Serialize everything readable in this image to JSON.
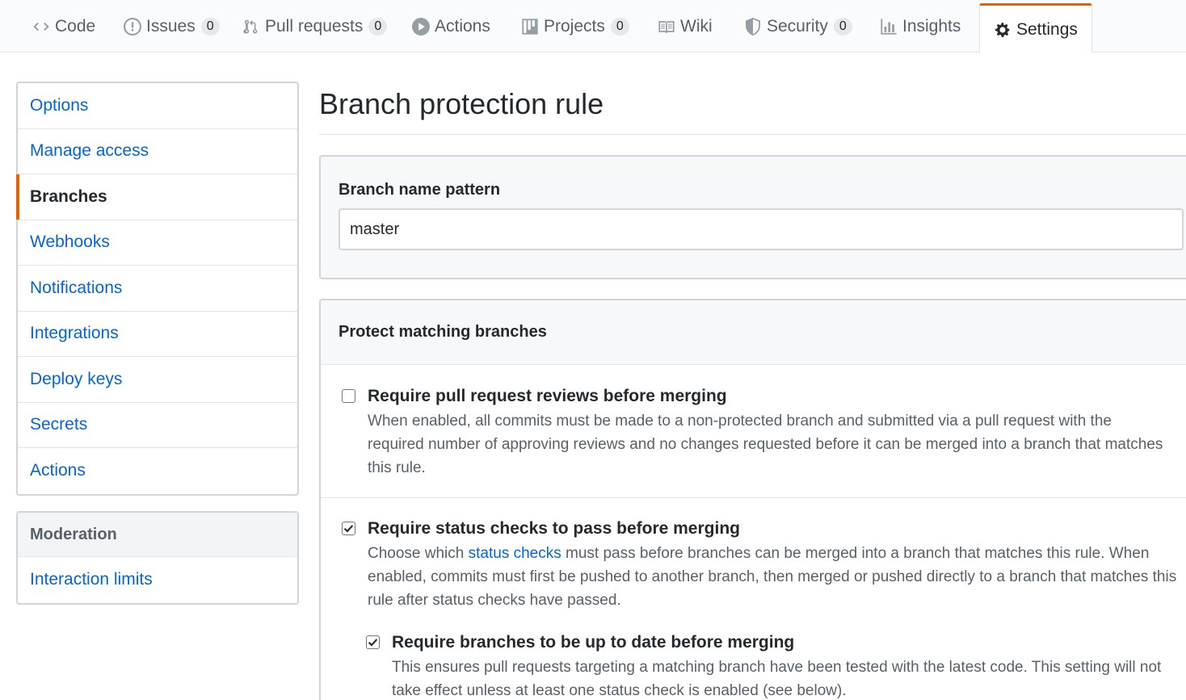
{
  "tabs": [
    {
      "icon": "code-icon",
      "label": "Code"
    },
    {
      "icon": "issue-icon",
      "label": "Issues",
      "count": "0"
    },
    {
      "icon": "pull-request-icon",
      "label": "Pull requests",
      "count": "0"
    },
    {
      "icon": "play-icon",
      "label": "Actions"
    },
    {
      "icon": "project-icon",
      "label": "Projects",
      "count": "0"
    },
    {
      "icon": "book-icon",
      "label": "Wiki"
    },
    {
      "icon": "shield-icon",
      "label": "Security",
      "count": "0"
    },
    {
      "icon": "graph-icon",
      "label": "Insights"
    },
    {
      "icon": "gear-icon",
      "label": "Settings",
      "selected": true
    }
  ],
  "sidebar": {
    "items": [
      {
        "label": "Options"
      },
      {
        "label": "Manage access"
      },
      {
        "label": "Branches",
        "active": true
      },
      {
        "label": "Webhooks"
      },
      {
        "label": "Notifications"
      },
      {
        "label": "Integrations"
      },
      {
        "label": "Deploy keys"
      },
      {
        "label": "Secrets"
      },
      {
        "label": "Actions"
      }
    ],
    "moderation": {
      "heading": "Moderation",
      "items": [
        {
          "label": "Interaction limits"
        }
      ]
    }
  },
  "main": {
    "title": "Branch protection rule",
    "pattern": {
      "label": "Branch name pattern",
      "value": "master"
    },
    "protect": {
      "heading": "Protect matching branches",
      "rules": {
        "reviews": {
          "checked": false,
          "title": "Require pull request reviews before merging",
          "description": "When enabled, all commits must be made to a non-protected branch and submitted via a pull request with the required number of approving reviews and no changes requested before it can be merged into a branch that matches this rule."
        },
        "status": {
          "checked": true,
          "title": "Require status checks to pass before merging",
          "desc_pre": "Choose which ",
          "desc_link": "status checks",
          "desc_post": " must pass before branches can be merged into a branch that matches this rule. When enabled, commits must first be pushed to another branch, then merged or pushed directly to a branch that matches this rule after status checks have passed."
        },
        "uptodate": {
          "checked": true,
          "title": "Require branches to be up to date before merging",
          "description": "This ensures pull requests targeting a matching branch have been tested with the latest code. This setting will not take effect unless at least one status check is enabled (see below)."
        }
      }
    }
  }
}
